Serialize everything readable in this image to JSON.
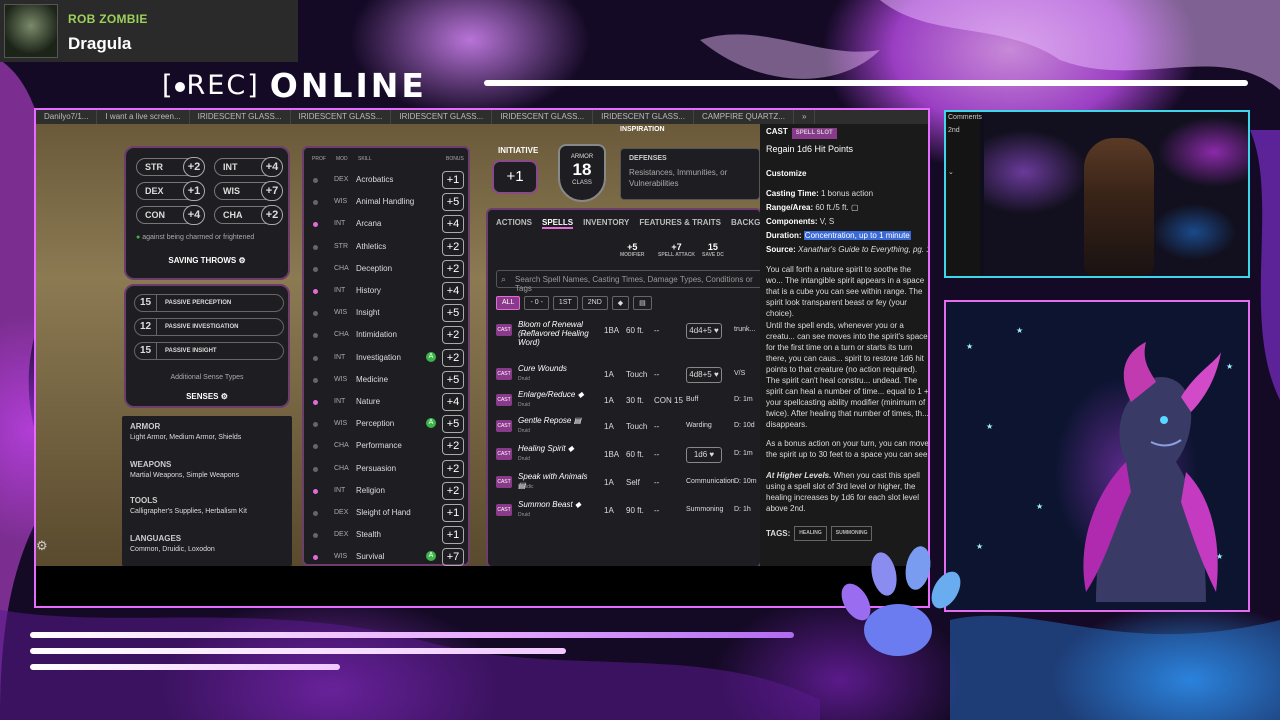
{
  "now_playing": {
    "artist": "ROB ZOMBIE",
    "track": "Dragula",
    "art_icon": "album-art"
  },
  "rec": {
    "label": "REC",
    "status": "ONLINE"
  },
  "browser": {
    "tabs": [
      "Danilyo7/1...",
      "I want a live screen...",
      "IRIDESCENT GLASS...",
      "IRIDESCENT GLASS...",
      "IRIDESCENT GLASS...",
      "IRIDESCENT GLASS...",
      "IRIDESCENT GLASS...",
      "CAMPFIRE QUARTZ...",
      "»"
    ]
  },
  "saves": {
    "items": [
      {
        "ability": "STR",
        "bonus": "+2"
      },
      {
        "ability": "INT",
        "bonus": "+4"
      },
      {
        "ability": "DEX",
        "bonus": "+1"
      },
      {
        "ability": "WIS",
        "bonus": "+7"
      },
      {
        "ability": "CON",
        "bonus": "+4"
      },
      {
        "ability": "CHA",
        "bonus": "+2"
      }
    ],
    "note": "against being charmed or frightened",
    "title": "SAVING THROWS"
  },
  "senses": {
    "passives": [
      {
        "value": "15",
        "label": "PASSIVE PERCEPTION"
      },
      {
        "value": "12",
        "label": "PASSIVE INVESTIGATION"
      },
      {
        "value": "15",
        "label": "PASSIVE INSIGHT"
      }
    ],
    "additional": "Additional Sense Types",
    "title": "SENSES"
  },
  "proficiencies": {
    "armor_h": "ARMOR",
    "armor": "Light Armor, Medium Armor, Shields",
    "weapons_h": "WEAPONS",
    "weapons": "Martial Weapons, Simple Weapons",
    "tools_h": "TOOLS",
    "tools": "Calligrapher's Supplies, Herbalism Kit",
    "languages_h": "LANGUAGES",
    "languages": "Common, Druidic, Loxodon"
  },
  "skills": {
    "headers": {
      "prof": "PROF",
      "mod": "MOD",
      "skill": "SKILL",
      "bonus": "BONUS"
    },
    "rows": [
      {
        "prof": false,
        "mod": "DEX",
        "name": "Acrobatics",
        "bonus": "+1",
        "adv": false
      },
      {
        "prof": false,
        "mod": "WIS",
        "name": "Animal Handling",
        "bonus": "+5",
        "adv": false
      },
      {
        "prof": true,
        "mod": "INT",
        "name": "Arcana",
        "bonus": "+4",
        "adv": false
      },
      {
        "prof": false,
        "mod": "STR",
        "name": "Athletics",
        "bonus": "+2",
        "adv": false
      },
      {
        "prof": false,
        "mod": "CHA",
        "name": "Deception",
        "bonus": "+2",
        "adv": false
      },
      {
        "prof": true,
        "mod": "INT",
        "name": "History",
        "bonus": "+4",
        "adv": false
      },
      {
        "prof": false,
        "mod": "WIS",
        "name": "Insight",
        "bonus": "+5",
        "adv": false
      },
      {
        "prof": false,
        "mod": "CHA",
        "name": "Intimidation",
        "bonus": "+2",
        "adv": false
      },
      {
        "prof": false,
        "mod": "INT",
        "name": "Investigation",
        "bonus": "+2",
        "adv": true
      },
      {
        "prof": false,
        "mod": "WIS",
        "name": "Medicine",
        "bonus": "+5",
        "adv": false
      },
      {
        "prof": true,
        "mod": "INT",
        "name": "Nature",
        "bonus": "+4",
        "adv": false
      },
      {
        "prof": false,
        "mod": "WIS",
        "name": "Perception",
        "bonus": "+5",
        "adv": true
      },
      {
        "prof": false,
        "mod": "CHA",
        "name": "Performance",
        "bonus": "+2",
        "adv": false
      },
      {
        "prof": false,
        "mod": "CHA",
        "name": "Persuasion",
        "bonus": "+2",
        "adv": false
      },
      {
        "prof": true,
        "mod": "INT",
        "name": "Religion",
        "bonus": "+2",
        "adv": false
      },
      {
        "prof": false,
        "mod": "DEX",
        "name": "Sleight of Hand",
        "bonus": "+1",
        "adv": false
      },
      {
        "prof": false,
        "mod": "DEX",
        "name": "Stealth",
        "bonus": "+1",
        "adv": false
      },
      {
        "prof": true,
        "mod": "WIS",
        "name": "Survival",
        "bonus": "+7",
        "adv": true
      }
    ]
  },
  "combat": {
    "initiative_label": "INITIATIVE",
    "initiative": "+1",
    "armor_label": "ARMOR",
    "ac": "18",
    "class_label": "CLASS",
    "inspiration": "INSPIRATION"
  },
  "defenses": {
    "title": "DEFENSES",
    "sub": "Resistances, Immunities, or Vulnerabilities"
  },
  "spells": {
    "tabs": [
      "ACTIONS",
      "SPELLS",
      "INVENTORY",
      "FEATURES & TRAITS",
      "BACKGROUND"
    ],
    "stats": [
      {
        "value": "+5",
        "label": "MODIFIER"
      },
      {
        "value": "+7",
        "label": "SPELL ATTACK"
      },
      {
        "value": "15",
        "label": "SAVE DC"
      }
    ],
    "search_placeholder": "Search Spell Names, Casting Times, Damage Types, Conditions or Tags",
    "filters": [
      "ALL",
      "- 0 -",
      "1ST",
      "2ND",
      "◆",
      "▤"
    ],
    "rows": [
      {
        "cast": "CAST",
        "name": "Bloom of Renewal (Reflavored Healing Word)",
        "class": "Druid",
        "time": "1BA",
        "range": "60 ft.",
        "hit": "--",
        "effect": "4d4+5 ♥",
        "notes": "trunk..."
      },
      {
        "cast": "CAST",
        "name": "Cure Wounds",
        "class": "Druid",
        "time": "1A",
        "range": "Touch",
        "hit": "--",
        "effect": "4d8+5 ♥",
        "notes": "V/S"
      },
      {
        "cast": "CAST",
        "name": "Enlarge/Reduce ◆",
        "class": "Druid",
        "time": "1A",
        "range": "30 ft.",
        "hit": "CON 15",
        "effect": "Buff",
        "notes": "D: 1m"
      },
      {
        "cast": "CAST",
        "name": "Gentle Repose ▤",
        "class": "Druid",
        "time": "1A",
        "range": "Touch",
        "hit": "--",
        "effect": "Warding",
        "notes": "D: 10d"
      },
      {
        "cast": "CAST",
        "name": "Healing Spirit ◆",
        "class": "Druid",
        "time": "1BA",
        "range": "60 ft.",
        "hit": "--",
        "effect": "1d6 ♥",
        "notes": "D: 1m"
      },
      {
        "cast": "CAST",
        "name": "Speak with Animals ▤",
        "class": "Druidic",
        "time": "1A",
        "range": "Self",
        "hit": "--",
        "effect": "Communication",
        "notes": "D: 10m"
      },
      {
        "cast": "CAST",
        "name": "Summon Beast ◆",
        "class": "Druid",
        "time": "1A",
        "range": "90 ft.",
        "hit": "--",
        "effect": "Summoning",
        "notes": "D: 1h"
      }
    ]
  },
  "detail": {
    "cast": "CAST",
    "cast_badge": "SPELL SLOT",
    "regain": "Regain 1d6 Hit Points",
    "customize": "Customize",
    "casting_time_k": "Casting Time:",
    "casting_time_v": "1 bonus action",
    "range_k": "Range/Area:",
    "range_v": "60 ft./5 ft.",
    "components_k": "Components:",
    "components_v": "V, S",
    "duration_k": "Duration:",
    "duration_v": "Concentration, up to 1 minute",
    "source_k": "Source:",
    "source_v": "Xanathar's Guide to Everything, pg. 1",
    "p1": "You call forth a nature spirit to soothe the wo... The intangible spirit appears in a space that is a cube you can see within range. The spirit look transparent beast or fey (your choice).",
    "p2": "Until the spell ends, whenever you or a creatu... can see moves into the spirit's space for the first time on a turn or starts its turn there, you can caus... spirit to restore 1d6 hit points to that creature (no action required). The spirit can't heal constru... undead. The spirit can heal a number of time... equal to 1 + your spellcasting ability modifier (minimum of twice). After healing that number of times, th... disappears.",
    "p3": "As a bonus action on your turn, you can move the spirit up to 30 feet to a space you can see.",
    "p4_b": "At Higher Levels.",
    "p4": " When you cast this spell using a spell slot of 3rd level or higher, the healing increases by 1d6 for each slot level above 2nd.",
    "tags_label": "TAGS:",
    "tags": [
      "HEALING",
      "SUMMONING"
    ]
  },
  "cam1": {
    "strip": [
      "Comments",
      "2nd"
    ]
  },
  "colors": {
    "accent_pink": "#e36bd4",
    "accent_cyan": "#3cd8e8",
    "advantage_green": "#3bb54a",
    "duration_highlight": "#3a6ad8"
  }
}
